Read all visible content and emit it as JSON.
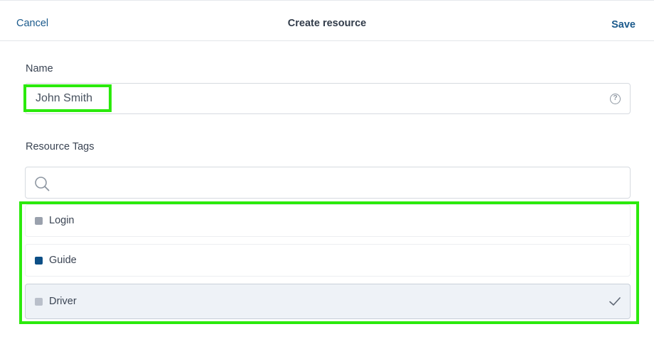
{
  "header": {
    "cancel_label": "Cancel",
    "title": "Create resource",
    "save_label": "Save"
  },
  "form": {
    "name_label": "Name",
    "name_value": "John Smith",
    "help_symbol": "?",
    "tags_label": "Resource Tags",
    "search_placeholder": "",
    "tags": [
      {
        "label": "Login",
        "color": "#9aa1ad",
        "selected": false
      },
      {
        "label": "Guide",
        "color": "#0d4f86",
        "selected": false
      },
      {
        "label": "Driver",
        "color": "#b9bfca",
        "selected": true
      }
    ]
  },
  "colors": {
    "accent": "#1b5a8c",
    "highlight": "#2bea0c",
    "selected_row_bg": "#eef2f7"
  },
  "icons": {
    "help": "question-circle-icon",
    "search": "search-icon",
    "selected": "checkmark-icon"
  }
}
